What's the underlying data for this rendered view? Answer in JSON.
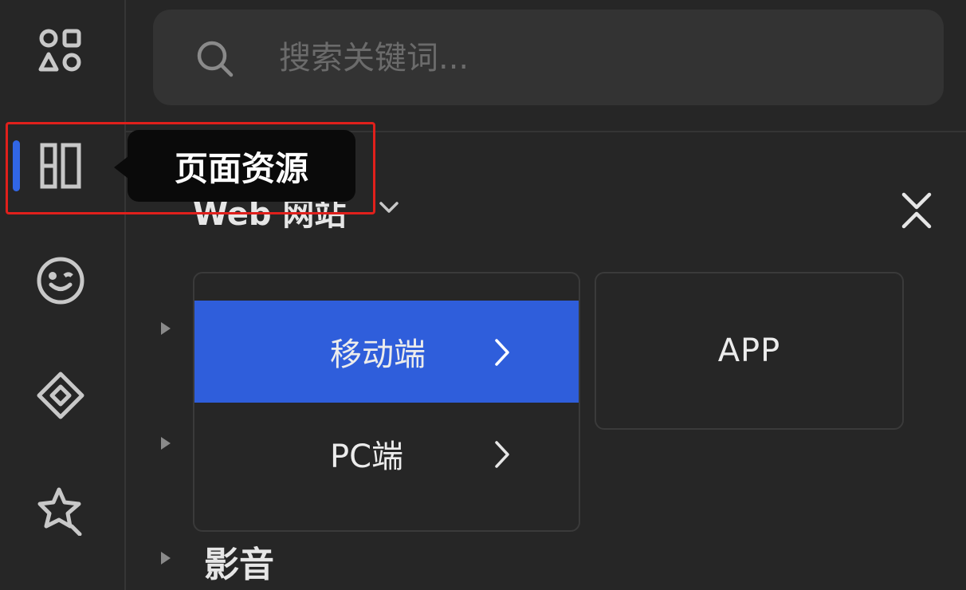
{
  "sidebar": {
    "items": [
      {
        "icon": "components-icon",
        "active": false
      },
      {
        "icon": "page-layout-icon",
        "active": true
      },
      {
        "icon": "emoji-icon",
        "active": false
      },
      {
        "icon": "diamond-icon",
        "active": false
      },
      {
        "icon": "sparkle-star-icon",
        "active": false
      }
    ],
    "accent_color": "#3166e6"
  },
  "tooltip": {
    "label": "页面资源"
  },
  "search": {
    "placeholder": "搜索关键词..."
  },
  "category": {
    "title": "Web 网站"
  },
  "tree": {
    "items": [
      {
        "label": "影音"
      }
    ]
  },
  "dropdown": {
    "items": [
      {
        "label": "移动端",
        "selected": true
      },
      {
        "label": "PC端",
        "selected": false
      }
    ],
    "selected_color": "#2f5edb"
  },
  "submenu": {
    "items": [
      {
        "label": "APP"
      }
    ]
  }
}
